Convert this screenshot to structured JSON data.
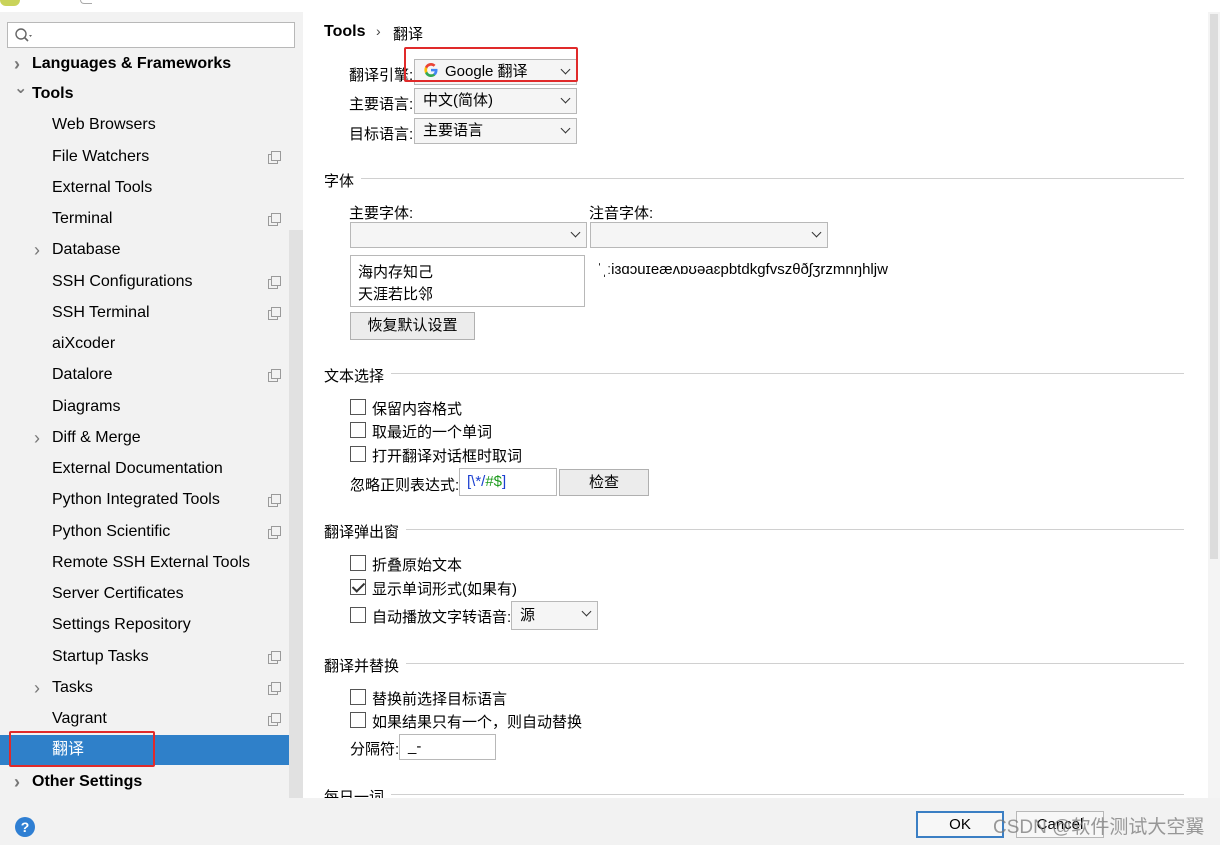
{
  "sidebar": {
    "search": {
      "placeholder": ""
    },
    "items": [
      {
        "label": "Languages & Frameworks",
        "bold": true,
        "chevron": "right"
      },
      {
        "label": "Tools",
        "bold": true,
        "chevron": "down"
      },
      {
        "label": "Web Browsers"
      },
      {
        "label": "File Watchers",
        "copy": true
      },
      {
        "label": "External Tools"
      },
      {
        "label": "Terminal",
        "copy": true
      },
      {
        "label": "Database",
        "chevron": "right"
      },
      {
        "label": "SSH Configurations",
        "copy": true
      },
      {
        "label": "SSH Terminal",
        "copy": true
      },
      {
        "label": "aiXcoder"
      },
      {
        "label": "Datalore",
        "copy": true
      },
      {
        "label": "Diagrams"
      },
      {
        "label": "Diff & Merge",
        "chevron": "right"
      },
      {
        "label": "External Documentation"
      },
      {
        "label": "Python Integrated Tools",
        "copy": true
      },
      {
        "label": "Python Scientific",
        "copy": true
      },
      {
        "label": "Remote SSH External Tools"
      },
      {
        "label": "Server Certificates"
      },
      {
        "label": "Settings Repository"
      },
      {
        "label": "Startup Tasks",
        "copy": true
      },
      {
        "label": "Tasks",
        "chevron": "right",
        "copy": true
      },
      {
        "label": "Vagrant",
        "copy": true
      },
      {
        "label": "翻译",
        "selected": true
      },
      {
        "label": "Other Settings",
        "bold": true,
        "chevron": "right"
      }
    ]
  },
  "breadcrumb": {
    "parent": "Tools",
    "separator": "›",
    "current": "翻译"
  },
  "engine": {
    "engine_label": "翻译引擎:",
    "engine_value": "Google 翻译",
    "primary_label": "主要语言:",
    "primary_value": "中文(简体)",
    "target_label": "目标语言:",
    "target_value": "主要语言"
  },
  "font": {
    "section": "字体",
    "primary_font_label": "主要字体:",
    "phonetic_font_label": "注音字体:",
    "preview_line1": "海内存知己",
    "preview_line2": "天涯若比邻",
    "phonetic_preview": "ˈˌːiɜɑɔuɪeæʌɒʊəaɛpbtdkgfvszθðʃʒrzmnŋhljw",
    "reset_button": "恢复默认设置"
  },
  "text_selection": {
    "section": "文本选择",
    "keep_format": "保留内容格式",
    "nearest_word": "取最近的一个单词",
    "on_dialog_open": "打开翻译对话框时取词",
    "ignore_regex_label": "忽略正则表达式:",
    "regex_part1": "[\\*/",
    "regex_part2": "#$",
    "regex_part3": "]",
    "check_button": "检查"
  },
  "popup": {
    "section": "翻译弹出窗",
    "fold_original": "折叠原始文本",
    "show_word_forms": "显示单词形式(如果有)",
    "auto_tts": "自动播放文字转语音:",
    "tts_value": "源"
  },
  "replace": {
    "section": "翻译并替换",
    "select_target": "替换前选择目标语言",
    "auto_replace": "如果结果只有一个，则自动替换",
    "separator_label": "分隔符:",
    "separator_value": "_-"
  },
  "daily": {
    "section": "每日一词"
  },
  "footer": {
    "help": "?",
    "ok": "OK",
    "cancel": "Cancel",
    "watermark": "CSDN @软件测试大空翼"
  },
  "colors": {
    "selection": "#2f80c9",
    "highlight_box": "#e02a2a",
    "regex_green": "#1a9a1a",
    "regex_blue": "#1a3fd0"
  }
}
